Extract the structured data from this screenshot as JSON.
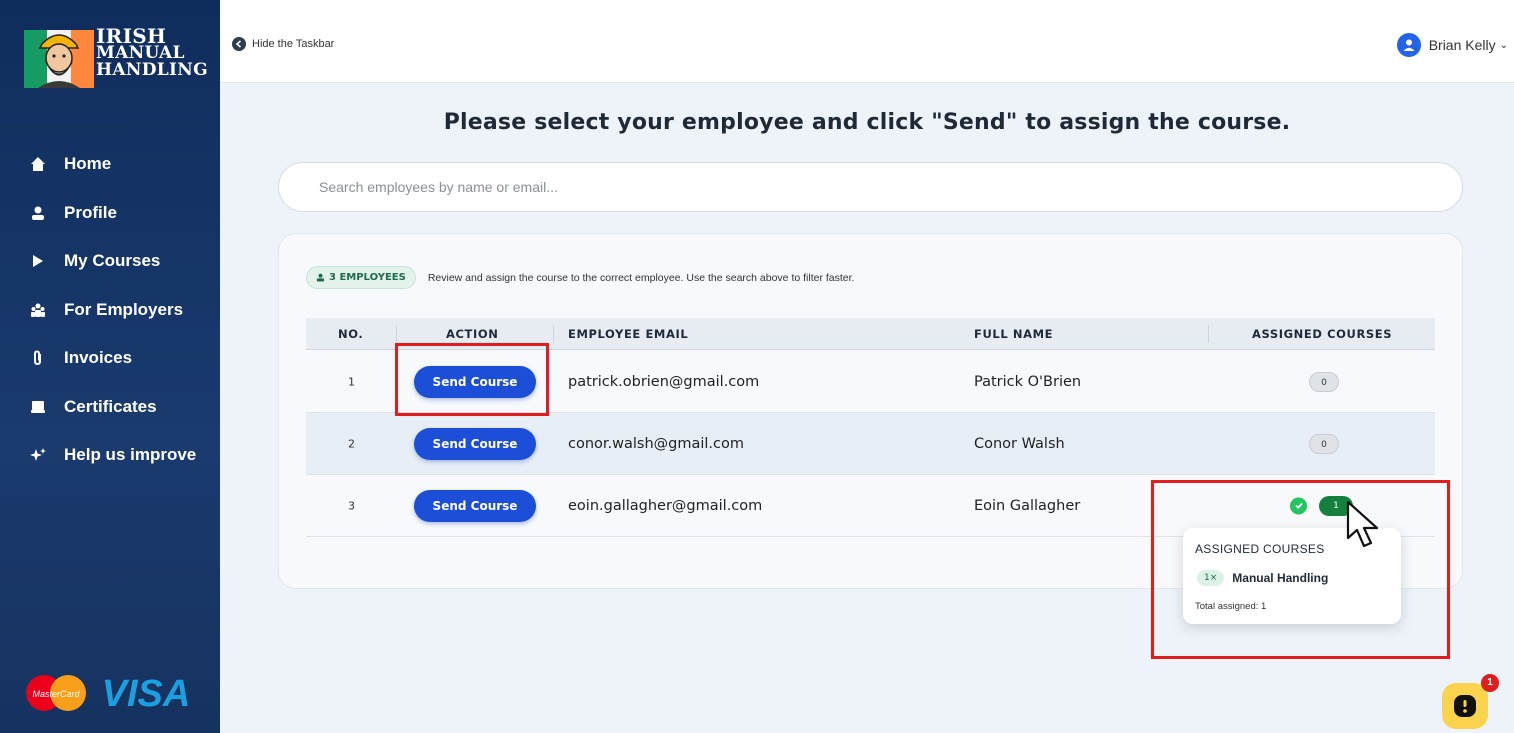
{
  "brand": {
    "line1": "IRISH",
    "line2": "MANUAL",
    "line3": "HANDLING"
  },
  "sidebar": {
    "items": [
      {
        "label": "Home",
        "icon": "home-icon"
      },
      {
        "label": "Profile",
        "icon": "user-icon"
      },
      {
        "label": "My Courses",
        "icon": "play-icon"
      },
      {
        "label": "For Employers",
        "icon": "team-icon"
      },
      {
        "label": "Invoices",
        "icon": "paperclip-icon"
      },
      {
        "label": "Certificates",
        "icon": "certificate-icon"
      },
      {
        "label": "Help us improve",
        "icon": "sparkle-icon"
      }
    ],
    "payment_logos": {
      "mastercard": "MasterCard",
      "visa": "VISA"
    }
  },
  "topbar": {
    "hide_taskbar": "Hide the Taskbar",
    "user_name": "Brian Kelly"
  },
  "page": {
    "title": "Please select your employee and click \"Send\" to assign the course.",
    "search_placeholder": "Search employees by name or email..."
  },
  "summary": {
    "count_label": "3 EMPLOYEES",
    "description": "Review and assign the course to the correct employee. Use the search above to filter faster."
  },
  "table": {
    "headers": {
      "no": "NO.",
      "action": "ACTION",
      "email": "EMPLOYEE EMAIL",
      "name": "FULL NAME",
      "courses": "ASSIGNED COURSES"
    },
    "rows": [
      {
        "no": "1",
        "action": "Send Course",
        "email": "patrick.obrien@gmail.com",
        "name": "Patrick O'Brien",
        "courses": "0"
      },
      {
        "no": "2",
        "action": "Send Course",
        "email": "conor.walsh@gmail.com",
        "name": "Conor Walsh",
        "courses": "0"
      },
      {
        "no": "3",
        "action": "Send Course",
        "email": "eoin.gallagher@gmail.com",
        "name": "Eoin Gallagher",
        "courses": "1"
      }
    ]
  },
  "popup": {
    "title": "ASSIGNED COURSES",
    "item_count": "1×",
    "item_name": "Manual Handling",
    "total": "Total assigned: 1"
  },
  "chat": {
    "badge": "1"
  },
  "colors": {
    "sidebar": "#0f2d5c",
    "primary_button": "#1d4ed8",
    "highlight": "#e11d1d",
    "assigned_green": "#15803d"
  }
}
